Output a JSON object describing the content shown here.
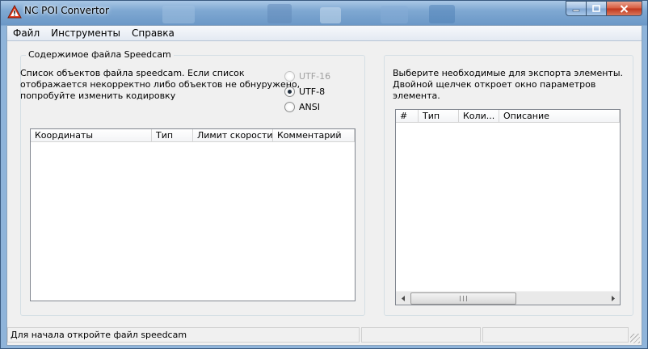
{
  "window": {
    "title": "NC POI Convertor"
  },
  "menu": {
    "items": [
      "Файл",
      "Инструменты",
      "Справка"
    ]
  },
  "left_group": {
    "title": "Содержимое файла Speedcam",
    "description": [
      "Список объектов файла speedcam. Если список",
      "отображается некорректно либо объектов не обнуружено,",
      "попробуйте  изменить кодировку"
    ],
    "encodings": [
      {
        "label": "UTF-16",
        "checked": false,
        "enabled": false
      },
      {
        "label": "UTF-8",
        "checked": true,
        "enabled": true
      },
      {
        "label": "ANSI",
        "checked": false,
        "enabled": true
      }
    ],
    "table": {
      "columns": [
        "Координаты",
        "Тип",
        "Лимит скорости",
        "Комментарий"
      ],
      "rows": []
    }
  },
  "right_group": {
    "description": [
      "Выберите необходимые для экспорта элементы.",
      "Двойной щелчек откроет окно параметров элемента."
    ],
    "table": {
      "columns": [
        "#",
        "Тип",
        "Коли...",
        "Описание"
      ],
      "rows": []
    }
  },
  "statusbar": {
    "text": "Для начала откройте файл speedcam",
    "pane2": "",
    "pane3": ""
  },
  "icons": {
    "app": "warning-triangle-icon",
    "minimize": "minimize-icon",
    "maximize": "maximize-icon",
    "close": "close-icon"
  },
  "colors": {
    "close_button": "#c7452a",
    "titlebar": "#7fa8d2"
  }
}
